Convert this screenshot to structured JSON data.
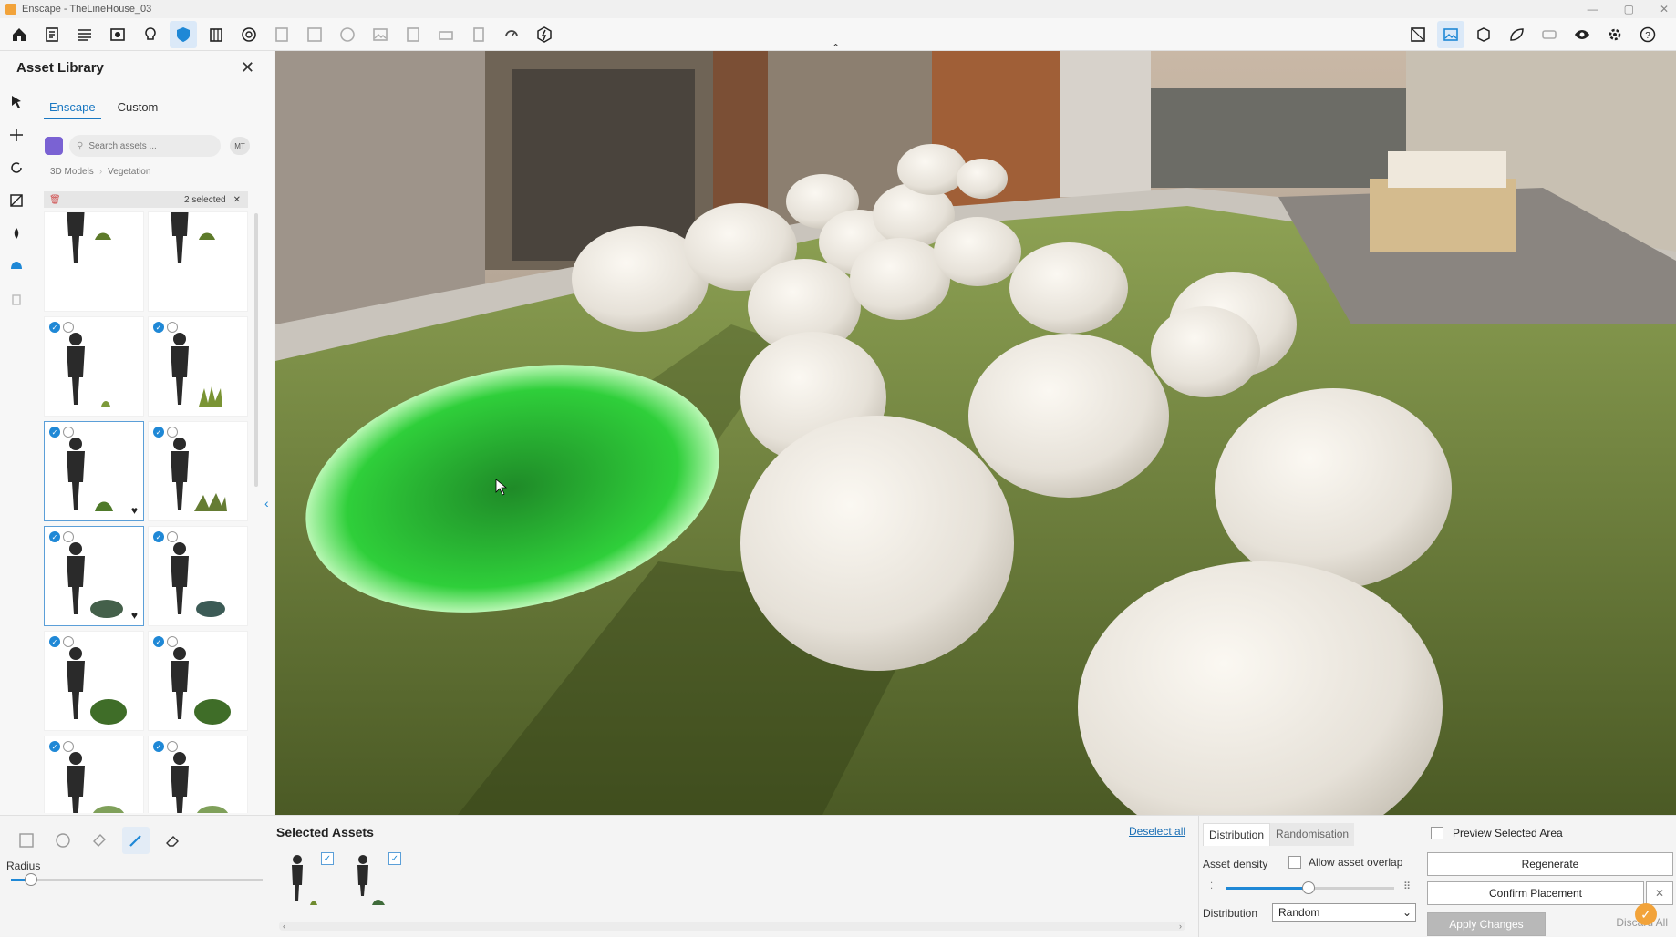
{
  "window": {
    "title": "Enscape - TheLineHouse_03"
  },
  "panel": {
    "title": "Asset Library",
    "tabs": [
      "Enscape",
      "Custom"
    ],
    "search_placeholder": "Search assets ...",
    "mt_label": "MT",
    "breadcrumb": [
      "3D Models",
      "Vegetation"
    ],
    "selected_count": "2 selected"
  },
  "bottom": {
    "radius_label": "Radius",
    "radius_value": 0.08,
    "selected_assets_title": "Selected Assets",
    "deselect_all": "Deselect all",
    "distribution_tabs": [
      "Distribution",
      "Randomisation"
    ],
    "asset_density_label": "Asset density",
    "asset_density_value": 0.49,
    "allow_overlap_label": "Allow asset overlap",
    "distribution_label": "Distribution",
    "distribution_value": "Random",
    "preview_label": "Preview Selected Area",
    "regenerate": "Regenerate",
    "confirm": "Confirm Placement",
    "apply": "Apply Changes",
    "discard": "Discard All"
  },
  "icons": {
    "toolbar_left": [
      "home-icon",
      "document-icon",
      "settings-list-icon",
      "view-icon",
      "light-bulb-icon",
      "asset-library-icon",
      "building-icon",
      "materials-icon",
      "export-icon",
      "batch-render-icon",
      "panorama-icon",
      "image-icon",
      "video-icon",
      "print-icon",
      "file-icon",
      "upload-icon",
      "sync-icon"
    ],
    "toolbar_right": [
      "map-icon",
      "gallery-icon",
      "cube-icon",
      "leaf-icon",
      "vr-icon",
      "eye-icon",
      "settings-icon",
      "help-icon"
    ],
    "accent": "#1f88d6"
  }
}
